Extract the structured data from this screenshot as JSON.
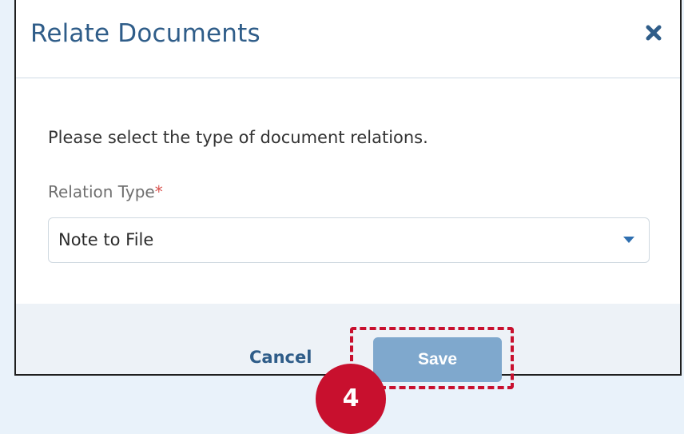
{
  "dialog": {
    "title": "Relate Documents",
    "close_icon": "close-icon",
    "instruction": "Please select the type of document relations.",
    "relation_type": {
      "label": "Relation Type",
      "required_mark": "*",
      "selected_value": "Note to File"
    },
    "cancel_label": "Cancel",
    "save_label": "Save"
  },
  "annotation": {
    "step_number": "4",
    "highlight_color": "#c8102e"
  },
  "colors": {
    "title": "#2f5d89",
    "save_button": "#7fa8cd",
    "background": "#e9f2fa"
  }
}
